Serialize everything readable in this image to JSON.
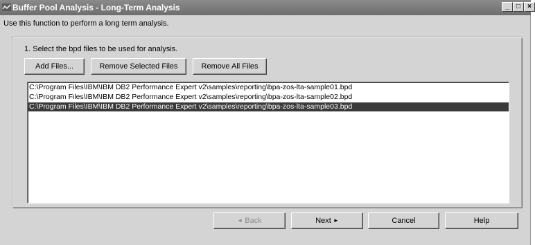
{
  "window": {
    "title": "Buffer Pool Analysis - Long-Term Analysis",
    "controls": {
      "minimize": "_",
      "maximize": "□",
      "close": "×"
    }
  },
  "instruction": "Use this function to perform a long term analysis.",
  "step": {
    "label": "1. Select the bpd files to be used for analysis.",
    "buttons": {
      "add": "Add Files...",
      "remove_selected": "Remove Selected Files",
      "remove_all": "Remove All Files"
    }
  },
  "files": [
    {
      "path": "C:\\Program Files\\IBM\\IBM DB2 Performance Expert v2\\samples\\reporting\\bpa-zos-lta-sample01.bpd",
      "selected": false
    },
    {
      "path": "C:\\Program Files\\IBM\\IBM DB2 Performance Expert v2\\samples\\reporting\\bpa-zos-lta-sample02.bpd",
      "selected": false
    },
    {
      "path": "C:\\Program Files\\IBM\\IBM DB2 Performance Expert v2\\samples\\reporting\\bpa-zos-lta-sample03.bpd",
      "selected": true
    }
  ],
  "nav": {
    "back": "Back",
    "back_glyph": "◄",
    "next": "Next",
    "next_glyph": "►",
    "cancel": "Cancel",
    "help": "Help",
    "back_enabled": false
  },
  "colors": {
    "title_bar": "#7a7a7a",
    "selection": "#3a3a3a",
    "window_bg": "#d4d4d4"
  }
}
